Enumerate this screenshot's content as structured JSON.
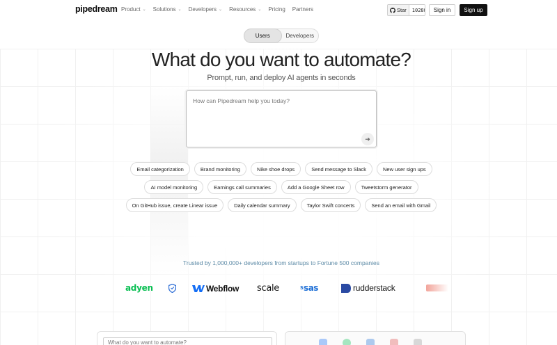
{
  "header": {
    "logo": "pipedream",
    "nav": [
      {
        "label": "Product",
        "dropdown": true
      },
      {
        "label": "Solutions",
        "dropdown": true
      },
      {
        "label": "Developers",
        "dropdown": true
      },
      {
        "label": "Resources",
        "dropdown": true
      },
      {
        "label": "Pricing",
        "dropdown": false
      },
      {
        "label": "Partners",
        "dropdown": false
      }
    ],
    "github": {
      "star_label": "Star",
      "count": "10288",
      "icon": "github-icon"
    },
    "signin_label": "Sign in",
    "signup_label": "Sign up"
  },
  "toggle": {
    "options": [
      "Users",
      "Developers"
    ],
    "selected": "Users"
  },
  "hero": {
    "title": "What do you want to automate?",
    "subtitle": "Prompt, run, and deploy AI agents in seconds"
  },
  "prompt": {
    "placeholder": "How can Pipedream help you today?",
    "send_icon": "arrow-right-icon"
  },
  "chips": [
    [
      "Email categorization",
      "Brand monitoring",
      "Nike shoe drops",
      "Send message to Slack",
      "New user sign ups"
    ],
    [
      "AI model monitoring",
      "Earnings call summaries",
      "Add a Google Sheet row",
      "Tweetstorm generator"
    ],
    [
      "On GitHub issue, create Linear issue",
      "Daily calendar summary",
      "Taylor Swift concerts",
      "Send an email with Gmail"
    ]
  ],
  "trusted": {
    "text": "Trusted by 1,000,000+ developers from startups to Fortune 500 companies",
    "logos": [
      "adyen",
      "shield-logo",
      "Webflow",
      "scale",
      "sas",
      "rudderstack",
      "faded-logo"
    ]
  },
  "bottom": {
    "input_placeholder": "What do you want to automate?"
  },
  "colors": {
    "accent_text": "#5c8aa6",
    "adyen": "#0abf53",
    "sas": "#1d6fd6",
    "dark": "#111111"
  }
}
